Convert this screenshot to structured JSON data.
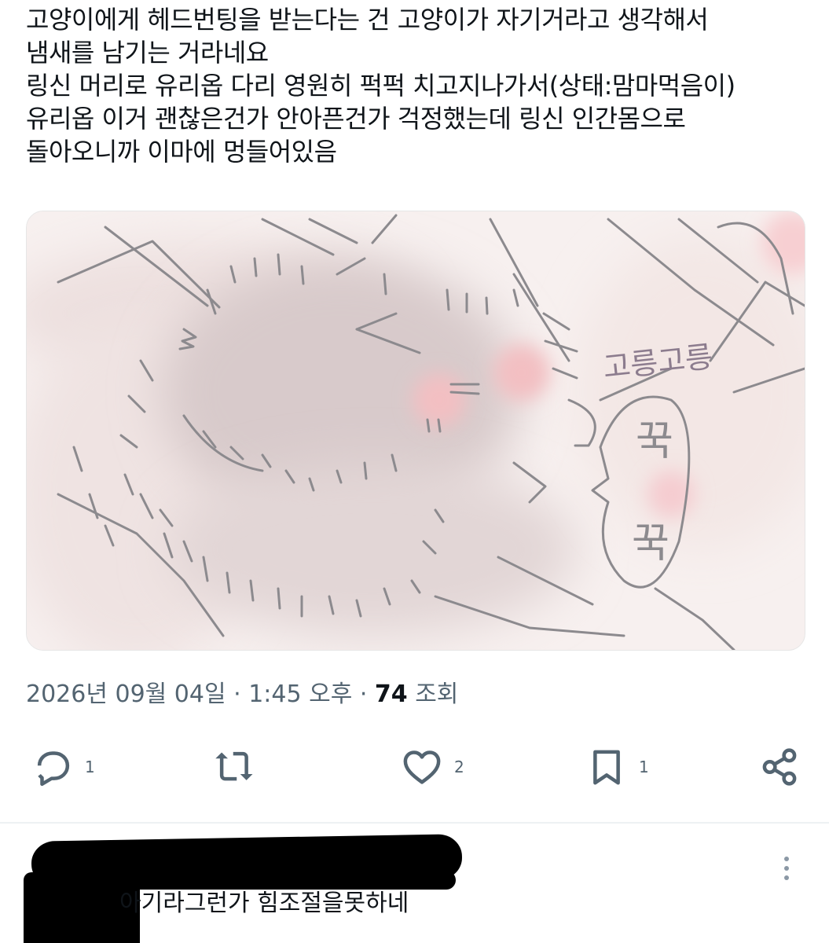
{
  "tweet": {
    "lines": [
      "고양이에게 헤드번팅을 받는다는 건 고양이가 자기거라고 생각해서",
      "냄새를 남기는 거라네요",
      "링신 머리로 유리옵 다리 영원히 퍽퍽 치고지나가서(상태:맘마먹음이)",
      "유리옵 이거 괜찮은건가 안아픈건가 걱정했는데 링신 인간몸으로",
      "돌아오니까 이마에 멍들어있음"
    ]
  },
  "media": {
    "sfx_purr": "고릉고릉",
    "sfx_squeeze_1": "꾹",
    "sfx_squeeze_2": "꾹"
  },
  "meta": {
    "date": "2026년 09월 04일",
    "sep1": " · ",
    "time": "1:45 오후",
    "sep2": " · ",
    "views_count": "74",
    "views_label": " 조회"
  },
  "actions": {
    "reply_count": "1",
    "retweet_count": "",
    "like_count": "2",
    "bookmark_count": "1",
    "icon_color": "#536471"
  },
  "reply": {
    "text": "아기라그런가 힘조절을못하네"
  }
}
